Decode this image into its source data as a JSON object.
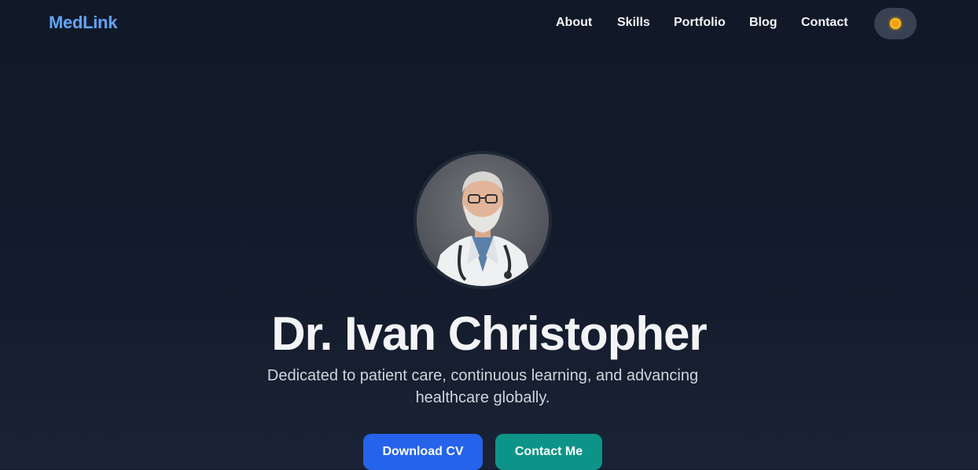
{
  "brand": {
    "name": "MedLink",
    "color": "#60a5fa"
  },
  "nav": {
    "items": [
      {
        "label": "About"
      },
      {
        "label": "Skills"
      },
      {
        "label": "Portfolio"
      },
      {
        "label": "Blog"
      },
      {
        "label": "Contact"
      }
    ],
    "theme_toggle_icon": "sun-icon"
  },
  "hero": {
    "avatar_icon": "doctor-portrait",
    "name": "Dr. Ivan Christopher",
    "tagline": "Dedicated to patient care, continuous learning, and advancing healthcare globally.",
    "buttons": {
      "download_cv": "Download CV",
      "contact_me": "Contact Me"
    }
  },
  "colors": {
    "background": "#111827",
    "primary_button": "#2563eb",
    "secondary_button": "#0d9488",
    "toggle_bg": "#374151"
  }
}
